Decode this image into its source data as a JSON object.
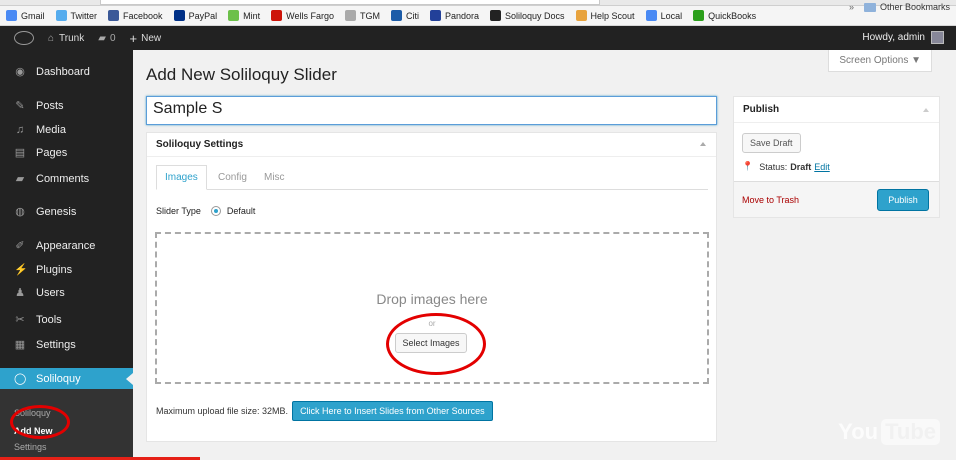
{
  "bookmarks": [
    {
      "label": "Gmail",
      "icon": "gmail-icon",
      "color": "#4a8af4"
    },
    {
      "label": "Twitter",
      "icon": "twitter-icon",
      "color": "#55acee"
    },
    {
      "label": "Facebook",
      "icon": "facebook-icon",
      "color": "#3b5998"
    },
    {
      "label": "PayPal",
      "icon": "paypal-icon",
      "color": "#003087"
    },
    {
      "label": "Mint",
      "icon": "mint-icon",
      "color": "#6cc04a"
    },
    {
      "label": "Wells Fargo",
      "icon": "wells-fargo-icon",
      "color": "#cd1409"
    },
    {
      "label": "TGM",
      "icon": "tgm-icon",
      "color": "#aaaaaa"
    },
    {
      "label": "Citi",
      "icon": "citi-icon",
      "color": "#1c5ca8"
    },
    {
      "label": "Pandora",
      "icon": "pandora-icon",
      "color": "#224099"
    },
    {
      "label": "Soliloquy Docs",
      "icon": "soliloquy-icon",
      "color": "#222222"
    },
    {
      "label": "Help Scout",
      "icon": "help-scout-icon",
      "color": "#e8a33d"
    },
    {
      "label": "Local",
      "icon": "local-icon",
      "color": "#4a8af4"
    },
    {
      "label": "QuickBooks",
      "icon": "quickbooks-icon",
      "color": "#2ca01c"
    }
  ],
  "bookmarks_more": "»",
  "other_bookmarks": "Other Bookmarks",
  "adminbar": {
    "site": "Trunk",
    "comments_count": "0",
    "new_label": "New",
    "howdy": "Howdy, admin"
  },
  "sidebar": {
    "items": [
      {
        "label": "Dashboard",
        "icon": "dashboard-icon",
        "glyph": "◉"
      },
      {
        "label": "Posts",
        "icon": "pin-icon",
        "glyph": "✎"
      },
      {
        "label": "Media",
        "icon": "media-icon",
        "glyph": "♫"
      },
      {
        "label": "Pages",
        "icon": "pages-icon",
        "glyph": "▤"
      },
      {
        "label": "Comments",
        "icon": "comments-icon",
        "glyph": "▰"
      },
      {
        "label": "Genesis",
        "icon": "genesis-icon",
        "glyph": "◍"
      },
      {
        "label": "Appearance",
        "icon": "appearance-icon",
        "glyph": "✐"
      },
      {
        "label": "Plugins",
        "icon": "plugins-icon",
        "glyph": "⚡"
      },
      {
        "label": "Users",
        "icon": "users-icon",
        "glyph": "♟"
      },
      {
        "label": "Tools",
        "icon": "tools-icon",
        "glyph": "✂"
      },
      {
        "label": "Settings",
        "icon": "settings-icon",
        "glyph": "▦"
      },
      {
        "label": "Soliloquy",
        "icon": "soliloquy-icon",
        "glyph": "◯"
      }
    ],
    "submenu": [
      "Soliloquy",
      "Add New",
      "Settings"
    ]
  },
  "main": {
    "title": "Add New Soliloquy Slider",
    "screen_options": "Screen Options ▼",
    "title_value": "Sample S"
  },
  "settings": {
    "heading": "Soliloquy Settings",
    "tabs": [
      "Images",
      "Config",
      "Misc"
    ],
    "slider_type_label": "Slider Type",
    "slider_type_value": "Default",
    "drop_text": "Drop images here",
    "or_text": "or",
    "select_button": "Select Images",
    "max_upload": "Maximum upload file size: 32MB.",
    "insert_button": "Click Here to Insert Slides from Other Sources"
  },
  "publish": {
    "heading": "Publish",
    "save_draft": "Save Draft",
    "status_label": "Status:",
    "status_value": "Draft",
    "edit_link": "Edit",
    "trash_link": "Move to Trash",
    "publish_button": "Publish"
  },
  "watermark": {
    "you": "You",
    "tube": "Tube"
  }
}
